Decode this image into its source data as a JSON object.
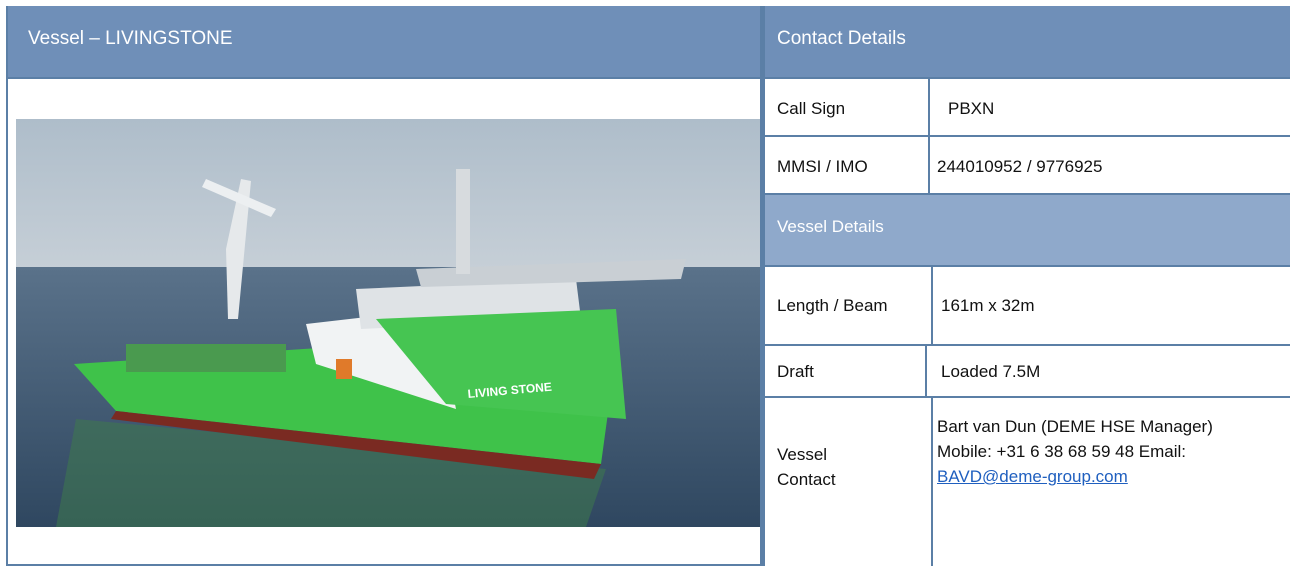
{
  "left_header": {
    "title": "Vessel – LIVINGSTONE"
  },
  "photo": {
    "ship_name_on_hull": "LIVING STONE",
    "colors": {
      "hull": "#3fc24a",
      "sea": "#43617d",
      "sky": "#b9c7d4"
    }
  },
  "right_header": {
    "title": "Contact Details"
  },
  "contact_rows": [
    {
      "label": "Call Sign",
      "value": "PBXN"
    },
    {
      "label": "MMSI / IMO",
      "value": "244010952 / 9776925"
    }
  ],
  "vessel_details_header": "Vessel Details",
  "vessel_rows": [
    {
      "label": "Length / Beam",
      "value": "161m x 32m"
    },
    {
      "label": "Draft",
      "value": "Loaded 7.5M"
    }
  ],
  "vessel_contact": {
    "label_line1": "Vessel",
    "label_line2": "Contact",
    "name_line": "Bart van Dun (DEME HSE Manager)",
    "mobile_line": "Mobile: +31 6 38 68 59 48 Email:",
    "email": "BAVD@deme-group.com"
  },
  "colors": {
    "header_bg": "#6f8fb8",
    "subheader_bg": "#8fa9cb",
    "border": "#5b7fa6",
    "link": "#1f5fbf"
  }
}
